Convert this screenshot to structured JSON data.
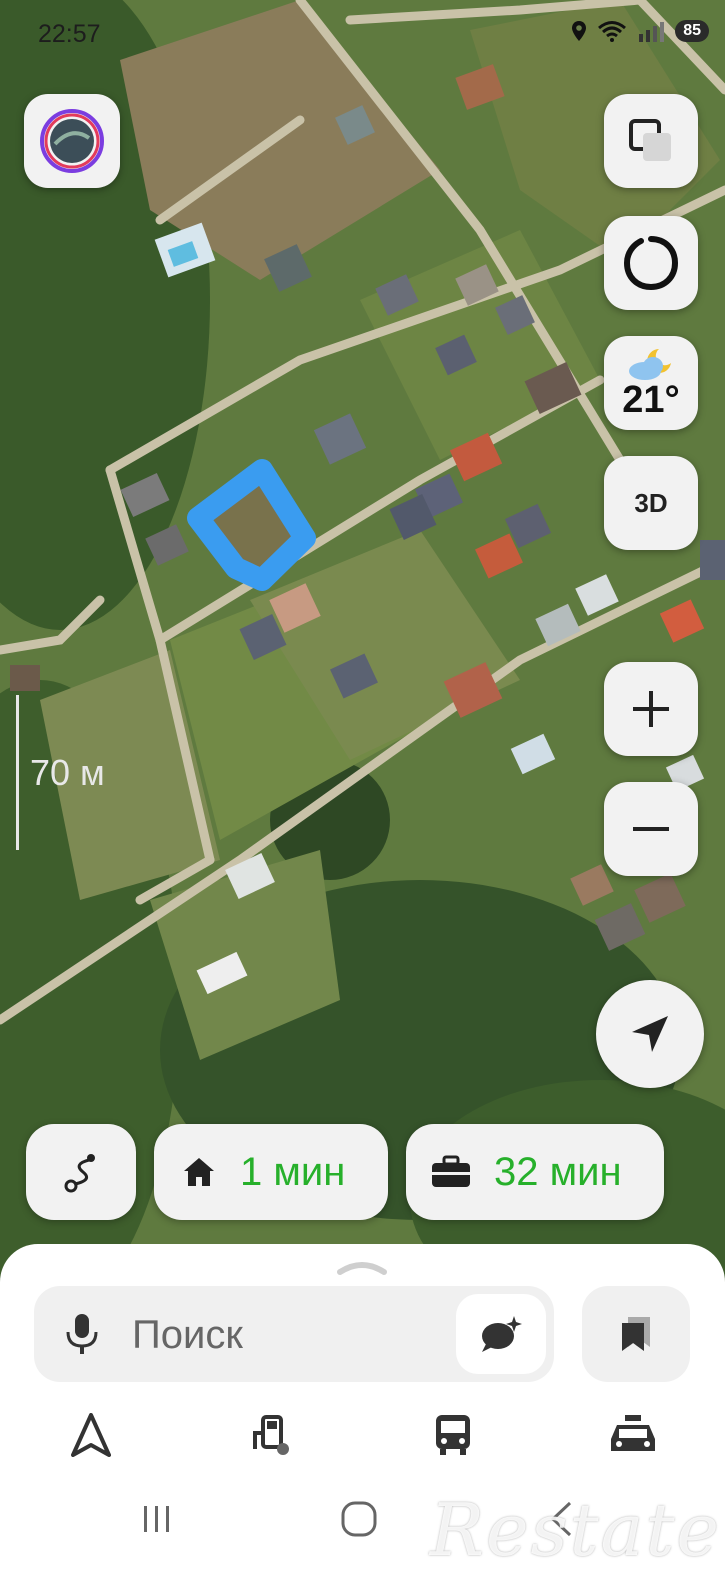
{
  "status_bar": {
    "time": "22:57",
    "battery": "85",
    "icons": [
      "location-icon",
      "wifi-icon",
      "signal-icon"
    ]
  },
  "map": {
    "scale_label": "70 м",
    "highlight_color": "#3a9cf0"
  },
  "controls": {
    "layers_icon": "layers-icon",
    "alice_icon": "alice-icon",
    "weather_temp": "21°",
    "weather_icon": "partly-cloudy-night-icon",
    "view_3d_label": "3D",
    "zoom_in_label": "+",
    "zoom_out_label": "−",
    "locate_icon": "navigation-arrow-icon"
  },
  "routes": {
    "route_icon": "route-icon",
    "home": {
      "icon": "home-icon",
      "time": "1 мин"
    },
    "work": {
      "icon": "briefcase-icon",
      "time": "32 мин"
    },
    "time_color": "#27b02b"
  },
  "bottom_sheet": {
    "search_placeholder": "Поиск",
    "mic_icon": "microphone-icon",
    "ai_icon": "ai-chat-icon",
    "bookmarks_icon": "bookmarks-icon",
    "tabs": [
      {
        "name": "navigator",
        "icon": "navigator-arrow-icon"
      },
      {
        "name": "fuel",
        "icon": "fuel-station-icon"
      },
      {
        "name": "transport",
        "icon": "bus-icon"
      },
      {
        "name": "taxi",
        "icon": "taxi-icon"
      }
    ]
  },
  "nav_bar": {
    "recents_icon": "recents-icon",
    "home_icon": "home-circle-icon",
    "back_icon": "back-icon"
  },
  "watermark": {
    "text": "Restate"
  }
}
